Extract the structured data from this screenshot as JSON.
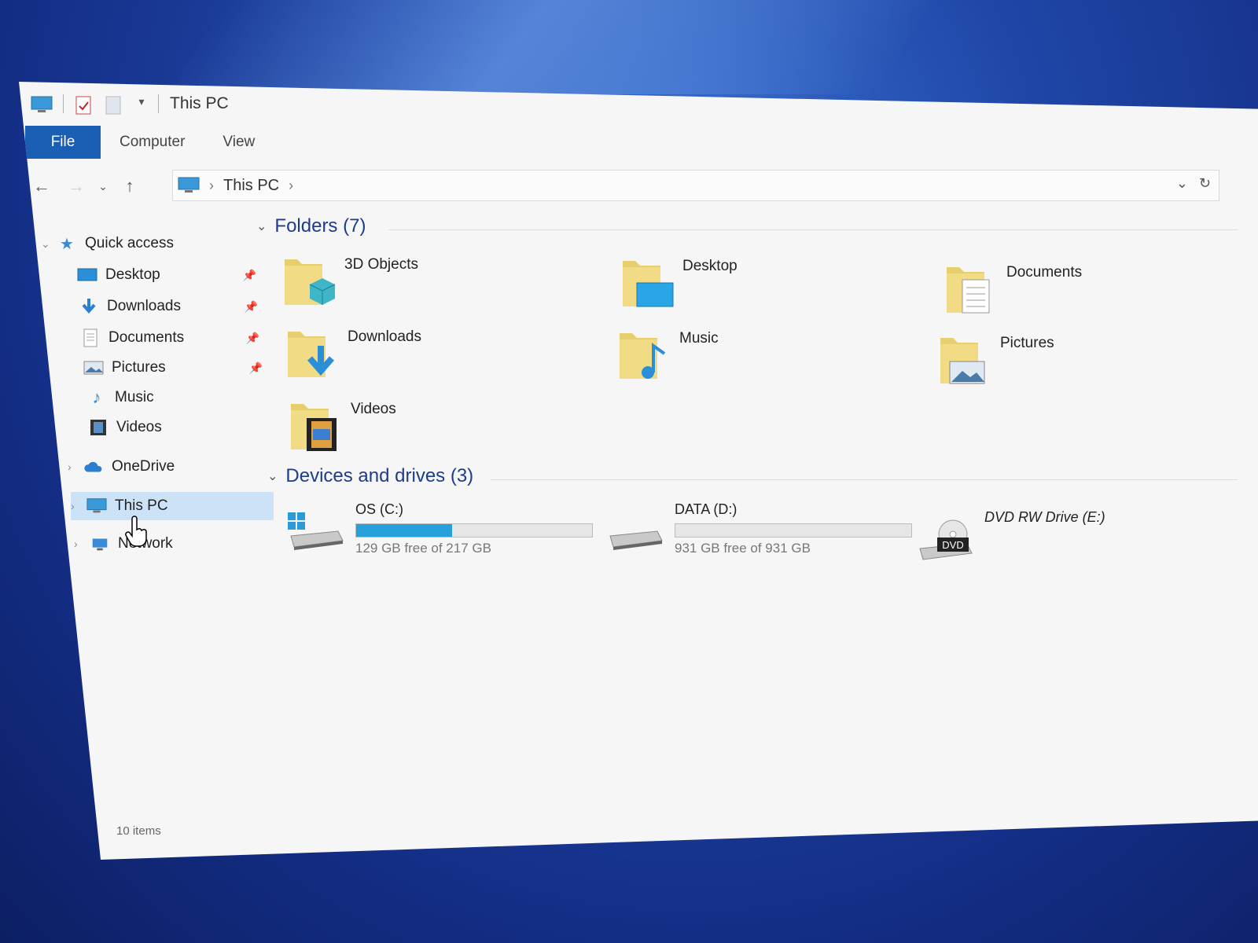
{
  "window": {
    "title": "This PC"
  },
  "ribbon": {
    "tabs": [
      "File",
      "Computer",
      "View"
    ]
  },
  "address": {
    "path": [
      "This PC"
    ]
  },
  "nav": {
    "quick_access": "Quick access",
    "quick_items": [
      {
        "label": "Desktop",
        "icon": "desktop-icon",
        "pinned": true
      },
      {
        "label": "Downloads",
        "icon": "downloads-icon",
        "pinned": true
      },
      {
        "label": "Documents",
        "icon": "documents-icon",
        "pinned": true
      },
      {
        "label": "Pictures",
        "icon": "pictures-icon",
        "pinned": true
      },
      {
        "label": "Music",
        "icon": "music-icon",
        "pinned": false
      },
      {
        "label": "Videos",
        "icon": "videos-icon",
        "pinned": false
      }
    ],
    "onedrive": "OneDrive",
    "this_pc": "This PC",
    "network": "Network"
  },
  "folders": {
    "header": "Folders (7)",
    "items": [
      "3D Objects",
      "Desktop",
      "Documents",
      "Downloads",
      "Music",
      "Pictures",
      "Videos"
    ]
  },
  "devices": {
    "header": "Devices and drives (3)",
    "drives": [
      {
        "name": "OS (C:)",
        "free": "129 GB free of 217 GB",
        "used_fraction": 0.406,
        "icon": "windows-drive-icon"
      },
      {
        "name": "DATA (D:)",
        "free": "931 GB free of 931 GB",
        "used_fraction": 0.0,
        "icon": "hard-drive-icon"
      },
      {
        "name": "DVD RW Drive (E:)",
        "icon": "dvd-drive-icon"
      }
    ]
  },
  "status": {
    "items": "10 items"
  },
  "colors": {
    "accent": "#1a5fb4",
    "drive_fill": "#26a0da",
    "header_text": "#1e3c8c",
    "folder": "#e8cf6e"
  }
}
